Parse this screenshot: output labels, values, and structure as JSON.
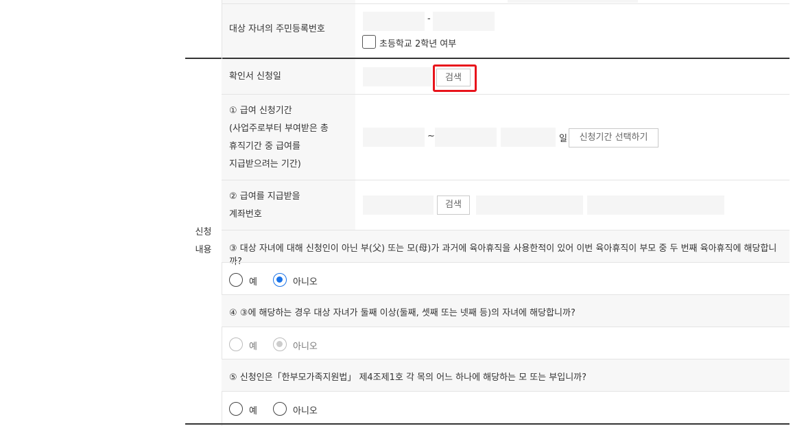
{
  "child": {
    "label": "대상 자녀의 주민등록번호",
    "dash": "-",
    "checkbox_label": "초등학교 2학년 여부"
  },
  "section_label_1": "신청",
  "section_label_2": "내용",
  "confirm_date": {
    "label": "확인서 신청일",
    "search_button": "검색"
  },
  "period": {
    "label_lines": [
      "① 급여 신청기간",
      "(사업주로부터 부여받은 총",
      "휴직기간 중 급여를",
      "지급받으려는 기간)"
    ],
    "tilde": "~",
    "day_unit": "일",
    "select_button": "신청기간 선택하기"
  },
  "account": {
    "label_lines": [
      "② 급여를 지급받을",
      "계좌번호"
    ],
    "search_button": "검색"
  },
  "q3": {
    "text": "③ 대상 자녀에 대해 신청인이 아닌 부(父) 또는 모(母)가 과거에 육아휴직을 사용한적이 있어 이번 육아휴직이 부모 중 두 번째 육아휴직에 해당합니까?",
    "yes": "예",
    "no": "아니오",
    "selected": "no"
  },
  "q4": {
    "text": "④ ③에 해당하는 경우 대상 자녀가 둘째 이상(둘째, 셋째 또는 넷째 등)의 자녀에 해당합니까?",
    "yes": "예",
    "no": "아니오",
    "selected": "no",
    "disabled": true
  },
  "q5": {
    "text": "⑤ 신청인은「한부모가족지원법」 제4조제1호 각 목의 어느 하나에 해당하는 모 또는 부입니까?",
    "yes": "예",
    "no": "아니오",
    "selected": null
  },
  "colors": {
    "highlight": "#e8141b",
    "radio_selected": "#1a73e8",
    "label_bg": "#f7f7f7",
    "field_bg": "#f5f5f5"
  }
}
